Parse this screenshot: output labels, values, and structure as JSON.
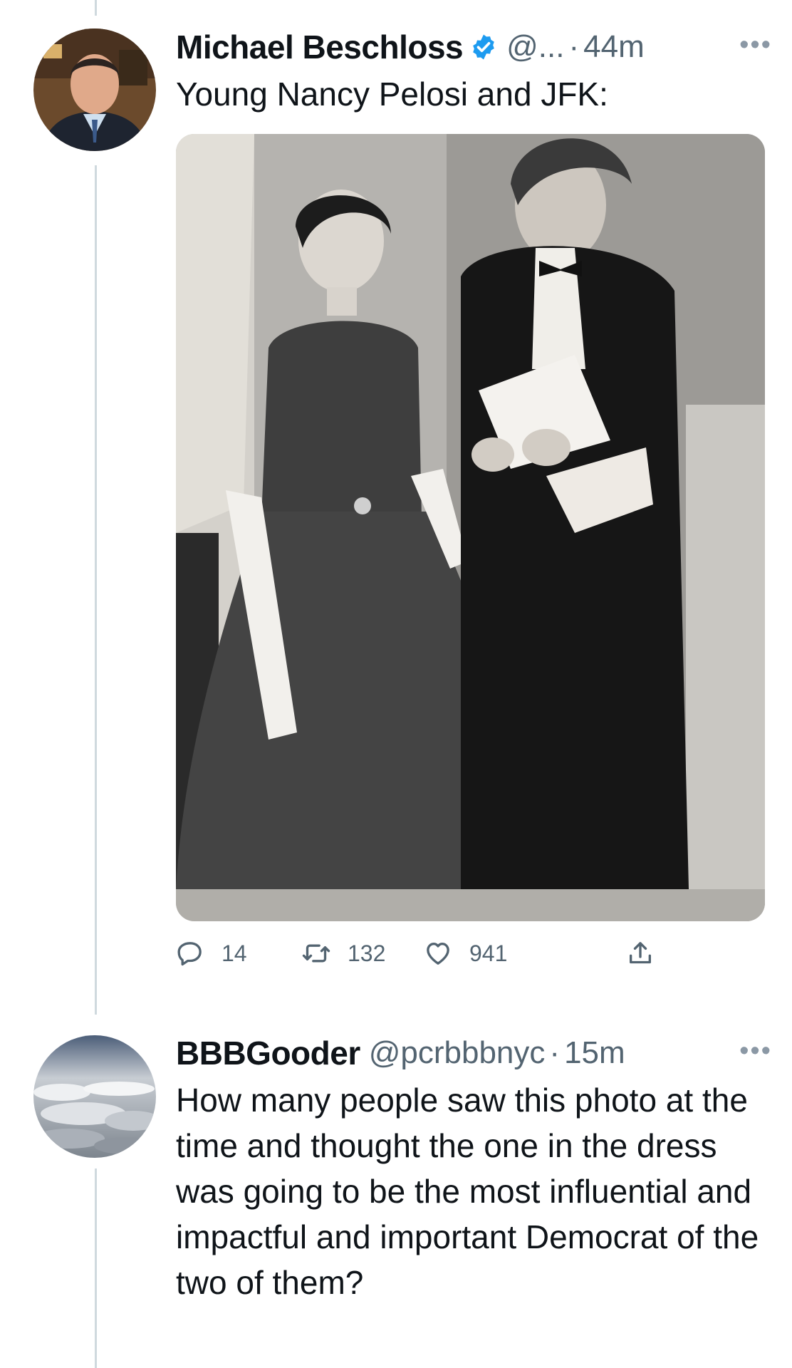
{
  "tweet": {
    "author": {
      "display_name": "Michael Beschloss",
      "handle": "@...",
      "time": "44m",
      "verified": true
    },
    "text": "Young Nancy Pelosi and JFK:",
    "media": {
      "type": "photo",
      "monochrome": true
    },
    "stats": {
      "replies": "14",
      "retweets": "132",
      "likes": "941"
    },
    "icons": {
      "reply": "reply-icon",
      "retweet": "retweet-icon",
      "like": "heart-icon",
      "share": "share-icon",
      "more": "more-icon",
      "verified": "verified-badge-icon"
    }
  },
  "reply": {
    "author": {
      "display_name": "BBBGooder",
      "handle": "@pcrbbbnyc",
      "time": "15m"
    },
    "text": "How many people saw this photo at the time and thought the one in the dress was going to be the most influential and impactful and important Democrat of the two of them?"
  },
  "separator": "·",
  "more_glyph": "•••",
  "colors": {
    "text": "#0f1419",
    "secondary": "#536471",
    "verified": "#1d9bf0",
    "thread_line": "#cfd9de"
  }
}
